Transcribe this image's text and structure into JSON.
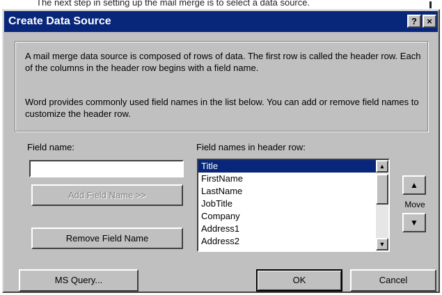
{
  "background": {
    "text": "The next step in setting up the mail merge is to select a data source."
  },
  "dialog": {
    "title": "Create Data Source",
    "help_label": "?",
    "close_label": "×",
    "info_para1": "A mail merge data source is composed of rows of data. The first row is called the header row. Each of the columns in the header row begins with a field name.",
    "info_para2": "Word provides commonly used field names in the list below. You can add or remove field names to customize the header row.",
    "field_name_label": "Field name:",
    "field_name_value": "",
    "field_names_label": "Field names in header row:",
    "field_names": [
      "Title",
      "FirstName",
      "LastName",
      "JobTitle",
      "Company",
      "Address1",
      "Address2"
    ],
    "selected_index": 0,
    "add_button": "Add Field Name  >>",
    "remove_button": "Remove Field Name",
    "move_label": "Move",
    "move_up_icon": "up-arrow",
    "move_down_icon": "down-arrow",
    "ms_query_button": "MS Query...",
    "ok_button": "OK",
    "cancel_button": "Cancel"
  },
  "colors": {
    "title_bar": "#08267a",
    "face": "#c0c0c0",
    "selection": "#08267a"
  }
}
